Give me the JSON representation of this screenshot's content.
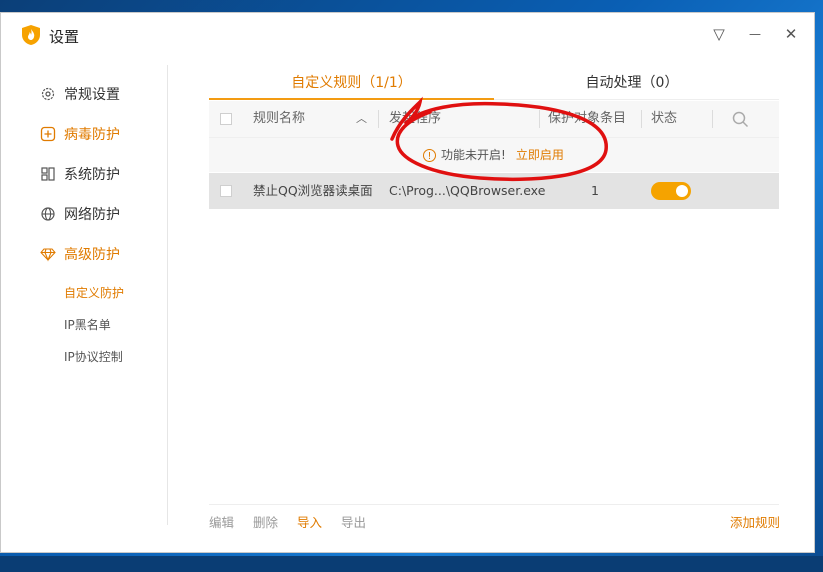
{
  "window": {
    "title": "设置",
    "controls": {
      "menu": "▽",
      "minimize": "—",
      "close": "✕"
    }
  },
  "sidebar": {
    "items": [
      {
        "label": "常规设置",
        "icon": "gear-icon",
        "active": false
      },
      {
        "label": "病毒防护",
        "icon": "plus-square-icon",
        "active": true
      },
      {
        "label": "系统防护",
        "icon": "grid-icon",
        "active": false
      },
      {
        "label": "网络防护",
        "icon": "globe-icon",
        "active": false
      },
      {
        "label": "高级防护",
        "icon": "diamond-icon",
        "active": true
      }
    ],
    "subitems": [
      {
        "label": "自定义防护",
        "active": true
      },
      {
        "label": "IP黑名单",
        "active": false
      },
      {
        "label": "IP协议控制",
        "active": false
      }
    ]
  },
  "tabs": [
    {
      "label": "自定义规则（1/1）",
      "active": true
    },
    {
      "label": "自动处理（0）",
      "active": false
    }
  ],
  "table": {
    "headers": {
      "name": "规则名称",
      "program": "发起程序",
      "target": "保护对象条目",
      "status": "状态"
    },
    "notice": {
      "text": "功能未开启!",
      "link": "立即启用"
    },
    "rows": [
      {
        "name": "禁止QQ浏览器读桌面",
        "program": "C:\\Prog...\\QQBrowser.exe",
        "target": "1",
        "status_on": true
      }
    ]
  },
  "footer": {
    "edit": "编辑",
    "delete": "删除",
    "import": "导入",
    "export": "导出",
    "add": "添加规则"
  },
  "colors": {
    "accent": "#f39b12",
    "annotation": "#e01010"
  }
}
